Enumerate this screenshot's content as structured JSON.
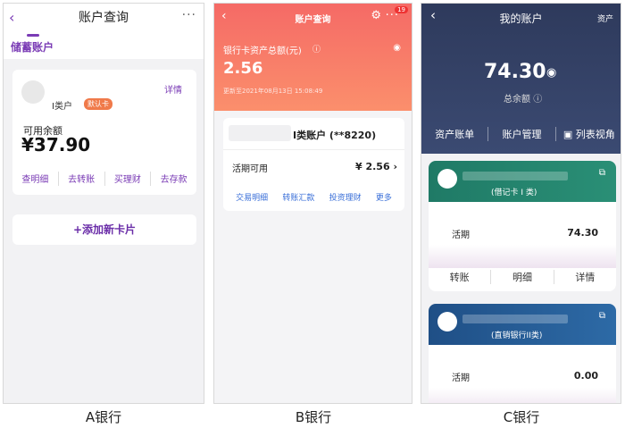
{
  "bank_a": {
    "title": "账户查询",
    "back_icon": "‹",
    "more_icon": "···",
    "tab": "储蓄账户",
    "card": {
      "account_class": "I类户",
      "default_badge": "默认卡",
      "detail_link": "详情",
      "balance_label": "可用余额",
      "balance": "¥37.90",
      "actions": [
        "查明细",
        "去转账",
        "买理财",
        "去存款"
      ]
    },
    "add_card": "+添加新卡片",
    "caption": "A银行"
  },
  "bank_b": {
    "title": "账户查询",
    "back_icon": "‹",
    "gear_icon": "⚙",
    "more_icon": "···",
    "notification_count": "19",
    "total_label": "银行卡资产总额(元)",
    "info_icon": "ⓘ",
    "eye_icon": "◉",
    "total": "2.56",
    "update_time": "更新至2021年08月13日 15:08:49",
    "account": "I类账户 (**8220)",
    "available_label": "活期可用",
    "available": "¥ 2.56",
    "chevron_icon": "›",
    "actions": [
      "交易明细",
      "转账汇款",
      "投资理财",
      "更多"
    ],
    "caption": "B银行"
  },
  "bank_c": {
    "title": "我的账户",
    "back_icon": "‹",
    "asset_link": "资产",
    "total": "74.30",
    "eye_icon": "◉",
    "total_label": "总余额",
    "info_icon": "ⓘ",
    "nav": [
      "资产账单",
      "账户管理",
      "▣ 列表视角"
    ],
    "cards": [
      {
        "type": "(借记卡 I 类)",
        "ext_icon": "⧉",
        "current_label": "活期",
        "current": "74.30",
        "actions": [
          "转账",
          "明细",
          "详情"
        ]
      },
      {
        "type": "(直销银行II类)",
        "ext_icon": "⧉",
        "current_label": "活期",
        "current": "0.00"
      }
    ],
    "caption": "C银行"
  }
}
